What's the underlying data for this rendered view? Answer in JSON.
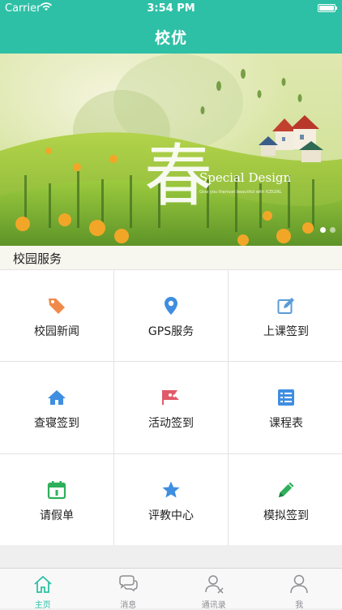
{
  "status_bar": {
    "carrier": "Carrier",
    "time": "3:54 PM",
    "wifi_icon": "wifi-icon",
    "battery_icon": "battery-icon"
  },
  "nav": {
    "title": "校优"
  },
  "banner": {
    "image_text_main": "春",
    "image_text_sub": "Special Design",
    "image_text_small": "Give you themost beautiful with ICEGIRL",
    "pages": 2,
    "active_page": 1
  },
  "section": {
    "title": "校园服务"
  },
  "services": [
    {
      "label": "校园新闻",
      "icon": "tag-icon",
      "color": "#f08a4b"
    },
    {
      "label": "GPS服务",
      "icon": "location-pin-icon",
      "color": "#3f8ee0"
    },
    {
      "label": "上课签到",
      "icon": "edit-icon",
      "color": "#5b9bd5"
    },
    {
      "label": "查寝签到",
      "icon": "home-icon",
      "color": "#3f8ee0"
    },
    {
      "label": "活动签到",
      "icon": "activity-flag-icon",
      "color": "#e05a6a"
    },
    {
      "label": "课程表",
      "icon": "schedule-list-icon",
      "color": "#3f8ee0"
    },
    {
      "label": "请假单",
      "icon": "calendar-icon",
      "color": "#2eaf5a"
    },
    {
      "label": "评教中心",
      "icon": "star-icon",
      "color": "#3f8ee0"
    },
    {
      "label": "模拟签到",
      "icon": "pencil-icon",
      "color": "#2eaf5a"
    }
  ],
  "tabs": [
    {
      "label": "主页",
      "icon": "home-tab-icon",
      "active": true
    },
    {
      "label": "消息",
      "icon": "chat-bubbles-icon",
      "active": false
    },
    {
      "label": "通讯录",
      "icon": "contacts-icon",
      "active": false
    },
    {
      "label": "我",
      "icon": "person-icon",
      "active": false
    }
  ],
  "colors": {
    "accent": "#2ec0a6",
    "tab_inactive": "#8e8e93"
  }
}
